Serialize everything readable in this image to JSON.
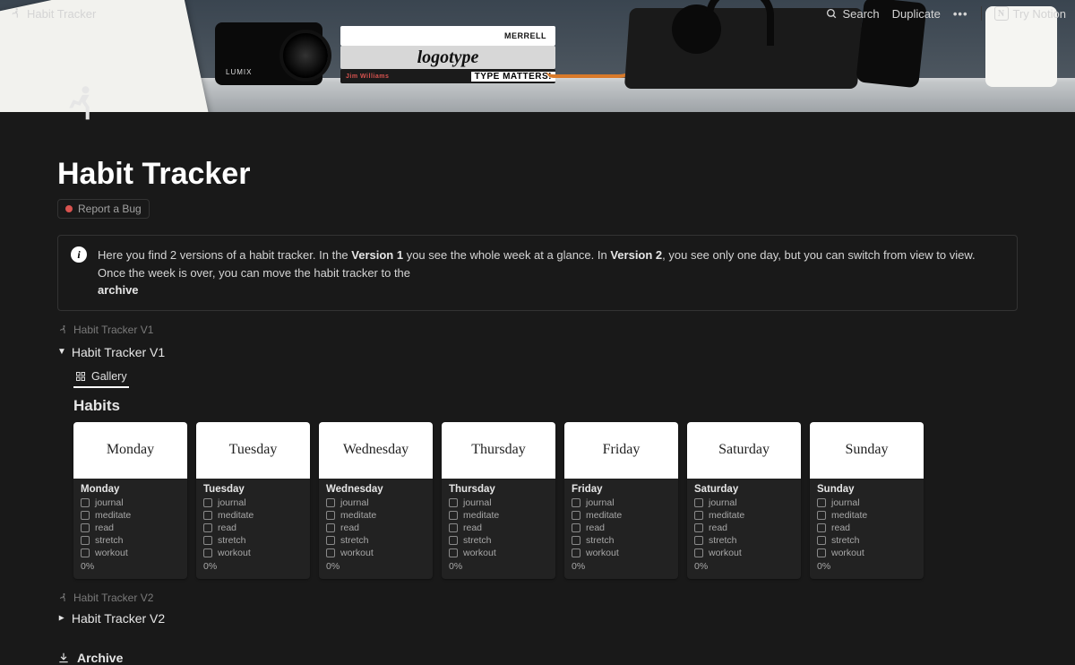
{
  "topbar": {
    "title": "Habit Tracker",
    "search": "Search",
    "duplicate": "Duplicate",
    "try_notion": "Try Notion"
  },
  "cover_books": {
    "top": "MERRELL",
    "mid": "logotype",
    "bot_left": "Jim Williams",
    "bot_right": "TYPE MATTERS!"
  },
  "page": {
    "title": "Habit Tracker",
    "report_bug": "Report a Bug",
    "callout_parts": {
      "p1": "Here you find 2 versions of a habit tracker. In the ",
      "v1": "Version 1",
      "p2": " you see the whole week at a glance. In ",
      "v2": "Version 2",
      "p3": ", you see only one day, but you can switch from view to view. Once the week is over, you can move the habit tracker to the ",
      "archive": "archive"
    },
    "linked_v1": "Habit Tracker V1",
    "toggle_v1": "Habit Tracker V1",
    "gallery_tab": "Gallery",
    "db_title": "Habits",
    "linked_v2": "Habit Tracker V2",
    "toggle_v2": "Habit Tracker V2",
    "archive": "Archive"
  },
  "habits": [
    "journal",
    "meditate",
    "read",
    "stretch",
    "workout"
  ],
  "days": [
    {
      "name": "Monday",
      "pct": "0%"
    },
    {
      "name": "Tuesday",
      "pct": "0%"
    },
    {
      "name": "Wednesday",
      "pct": "0%"
    },
    {
      "name": "Thursday",
      "pct": "0%"
    },
    {
      "name": "Friday",
      "pct": "0%"
    },
    {
      "name": "Saturday",
      "pct": "0%"
    },
    {
      "name": "Sunday",
      "pct": "0%"
    }
  ]
}
